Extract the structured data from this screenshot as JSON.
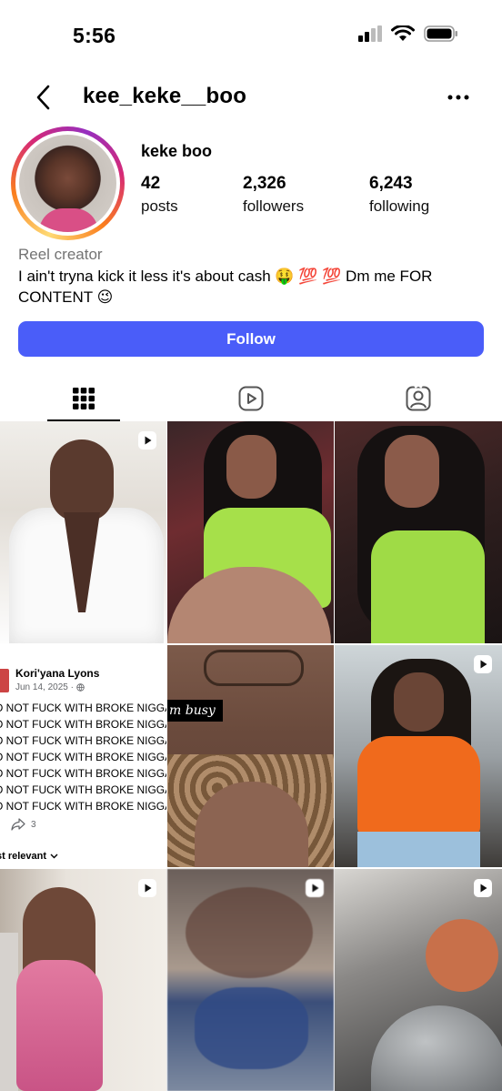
{
  "status_bar": {
    "time": "5:56"
  },
  "header": {
    "username": "kee_keke__boo"
  },
  "profile": {
    "display_name": "keke boo",
    "stats": {
      "posts": {
        "value": "42",
        "label": "posts"
      },
      "followers": {
        "value": "2,326",
        "label": "followers"
      },
      "following": {
        "value": "6,243",
        "label": "following"
      }
    },
    "category": "Reel creator",
    "bio": "I ain't tryna kick it less it's about cash 🤑 💯 💯  Dm me FOR CONTENT 😉",
    "follow_label": "Follow"
  },
  "colors": {
    "follow_button": "#4a5df9",
    "category_text": "#737373"
  },
  "tabs": [
    {
      "name": "grid",
      "icon": "grid-icon",
      "active": true
    },
    {
      "name": "reels",
      "icon": "reels-icon",
      "active": false
    },
    {
      "name": "tagged",
      "icon": "tagged-icon",
      "active": false
    }
  ],
  "grid_posts": {
    "post4": {
      "author": "Kori'yana Lyons",
      "date": "Jun 14, 2025 · ",
      "lines": [
        "O NOT FUCK WITH BROKE NIGGA",
        "O NOT FUCK WITH BROKE NIGGA",
        "O NOT FUCK WITH BROKE NIGGA",
        "O NOT FUCK WITH BROKE NIGGA",
        "O NOT FUCK WITH BROKE NIGGA",
        "O NOT FUCK WITH BROKE NIGGA",
        "O NOT FUCK WITH BROKE NIGGA"
      ],
      "shares": "3",
      "sort_label": "st relevant"
    },
    "post5": {
      "overlay_text": "m busy"
    }
  }
}
